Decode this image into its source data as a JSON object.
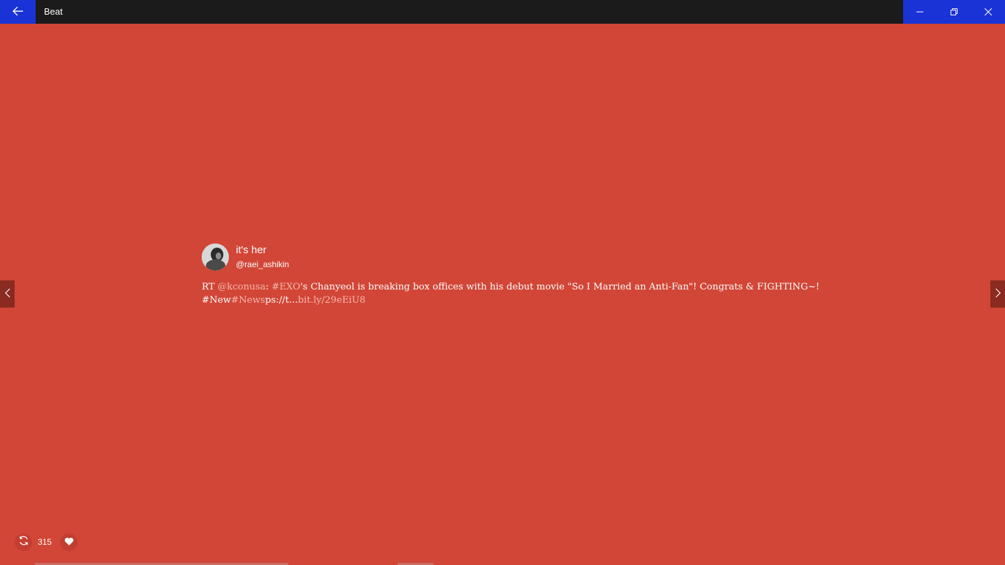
{
  "window": {
    "title": "Beat",
    "back_icon": "arrow-left-icon",
    "minimize_icon": "minimize-icon",
    "restore_icon": "restore-icon",
    "close_icon": "close-icon",
    "accent_color": "#1a33d6",
    "background_color": "#d24637"
  },
  "tweet": {
    "display_name": "it's her",
    "handle": "@raei_ashikin",
    "text_line1_parts": {
      "prefix": "RT ",
      "mention": "@kconusa",
      "colon": ": ",
      "hashtag": "#EXO",
      "body": "'s Chanyeol is breaking box offices with his debut movie \"So I Married an Anti-Fan\"! Congrats & FIGHTING~!"
    },
    "text_line2_parts": {
      "tag1": "#New",
      "tag2": "#News",
      "trail": "ps://t...",
      "link": "bit.ly/29eEiU8"
    }
  },
  "footer": {
    "retweet_icon": "retweet-icon",
    "retweet_count": "315",
    "like_icon": "heart-icon"
  },
  "navigation": {
    "prev_icon": "chevron-left-icon",
    "next_icon": "chevron-right-icon"
  }
}
